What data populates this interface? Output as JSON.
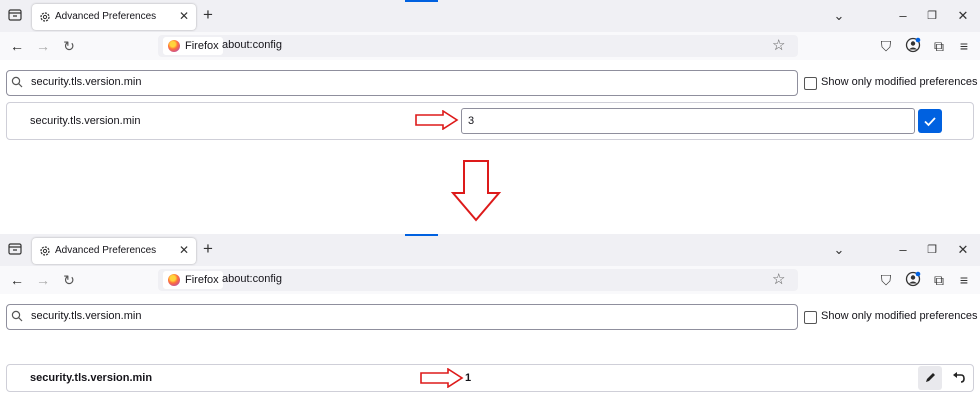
{
  "colors": {
    "accent": "#0061e0",
    "annotation_arrow": "#dd1a1a"
  },
  "panels": [
    {
      "tab": {
        "title": "Advanced Preferences"
      },
      "urlbar": {
        "identity_label": "Firefox",
        "url": "about:config"
      },
      "search": {
        "value": "security.tls.version.min"
      },
      "modified_filter": {
        "label": "Show only modified preferences",
        "checked": false
      },
      "pref": {
        "name": "security.tls.version.min",
        "input_value": "3",
        "mode": "editing"
      }
    },
    {
      "tab": {
        "title": "Advanced Preferences"
      },
      "urlbar": {
        "identity_label": "Firefox",
        "url": "about:config"
      },
      "search": {
        "value": "security.tls.version.min"
      },
      "modified_filter": {
        "label": "Show only modified preferences",
        "checked": false
      },
      "pref": {
        "name": "security.tls.version.min",
        "value": "1",
        "mode": "modified"
      }
    }
  ],
  "icons": [
    "tab-list-icon",
    "gear-icon",
    "close-icon",
    "plus-icon",
    "chevron-down-icon",
    "minimize-icon",
    "restore-icon",
    "back-icon",
    "forward-icon",
    "reload-icon",
    "star-icon",
    "pocket-icon",
    "account-icon",
    "extensions-icon",
    "menu-icon",
    "search-icon",
    "checkmark-icon",
    "pencil-icon",
    "undo-icon",
    "arrow-right-icon",
    "arrow-down-icon"
  ]
}
